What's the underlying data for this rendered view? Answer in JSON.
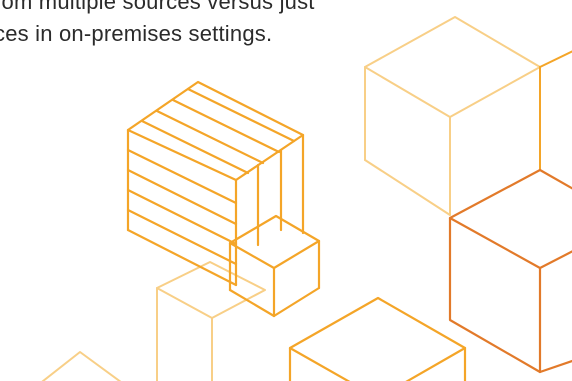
{
  "text": {
    "line1": "rom multiple sources versus just",
    "line2": "ces in on-premises settings."
  },
  "colors": {
    "light": "#f8cf87",
    "medium": "#f4a528",
    "dark": "#e27a2a"
  },
  "icons": [
    "stacked-cube-icon",
    "cube-icon"
  ]
}
